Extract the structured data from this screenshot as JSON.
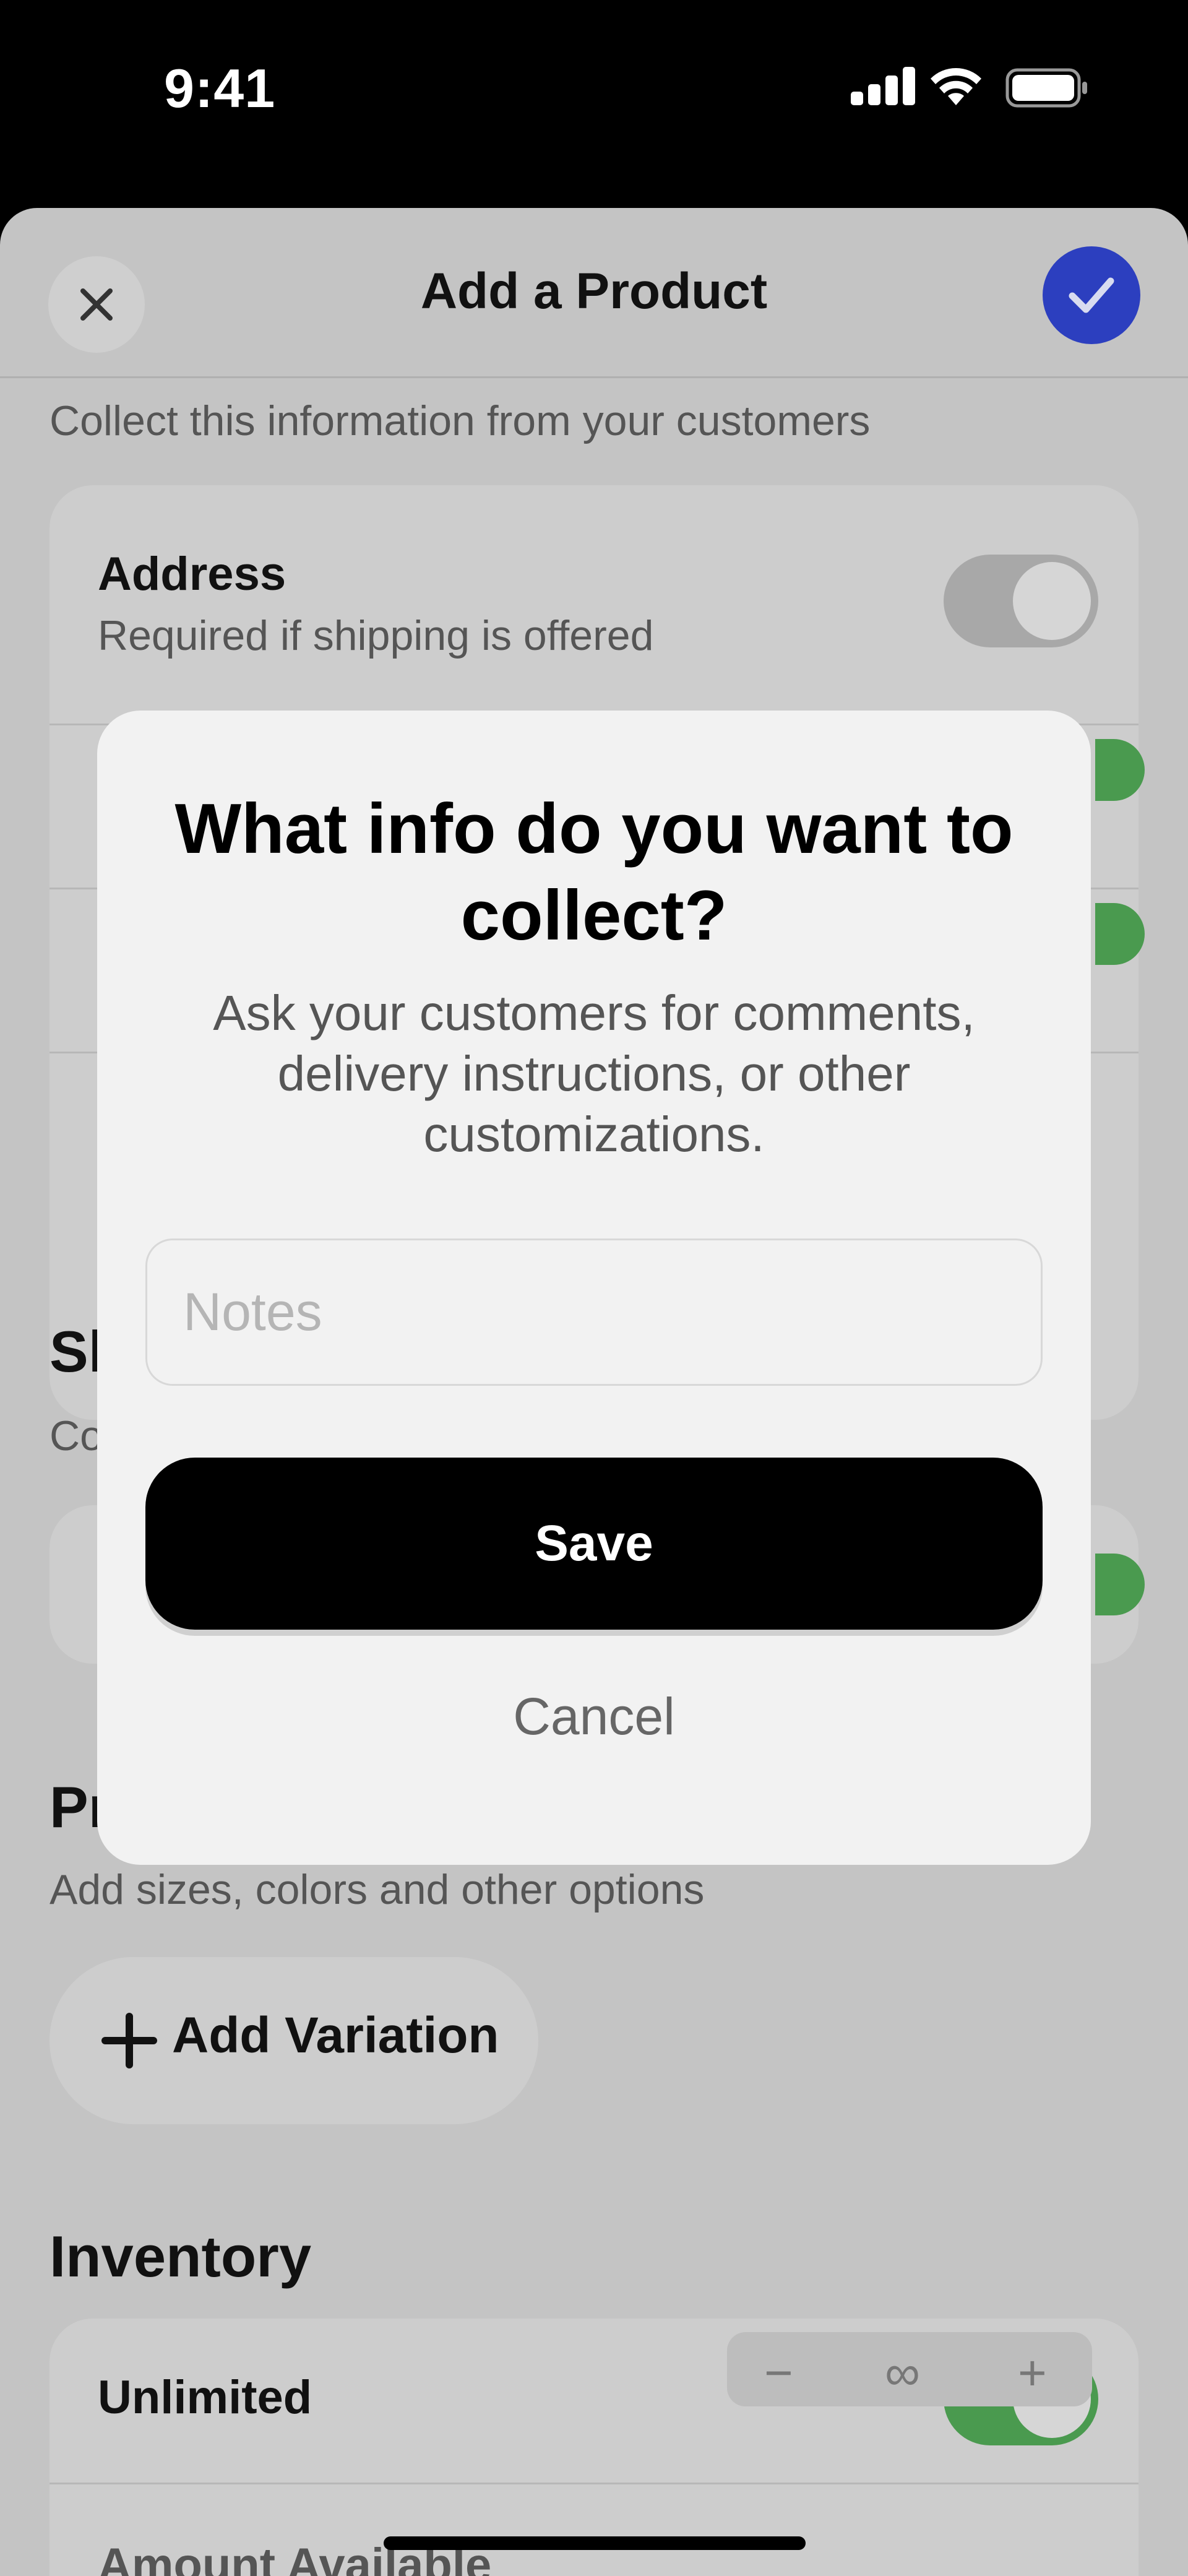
{
  "status_bar": {
    "time": "9:41"
  },
  "header": {
    "title": "Add a Product"
  },
  "collect": {
    "description": "Collect this information from your customers",
    "address": {
      "title": "Address",
      "subtitle": "Required if shipping is offered",
      "enabled": false
    }
  },
  "shipping": {
    "heading_partial": "Sh",
    "description_partial": "Co"
  },
  "product_options": {
    "heading_partial": "Pr",
    "description": "Add sizes, colors and other options",
    "add_variation_label": "Add Variation"
  },
  "inventory": {
    "heading": "Inventory",
    "unlimited_label": "Unlimited",
    "unlimited_enabled": true,
    "amount_label": "Amount Available",
    "stepper": {
      "minus": "−",
      "value": "∞",
      "plus": "+"
    }
  },
  "modal": {
    "title": "What info do you want to collect?",
    "subtitle": "Ask your customers for comments, delivery instructions, or other customizations.",
    "notes_placeholder": "Notes",
    "notes_value": "",
    "save_label": "Save",
    "cancel_label": "Cancel"
  },
  "colors": {
    "confirm_blue": "#2c3fbf",
    "toggle_green": "#4a9a4f",
    "save_black": "#000000"
  }
}
